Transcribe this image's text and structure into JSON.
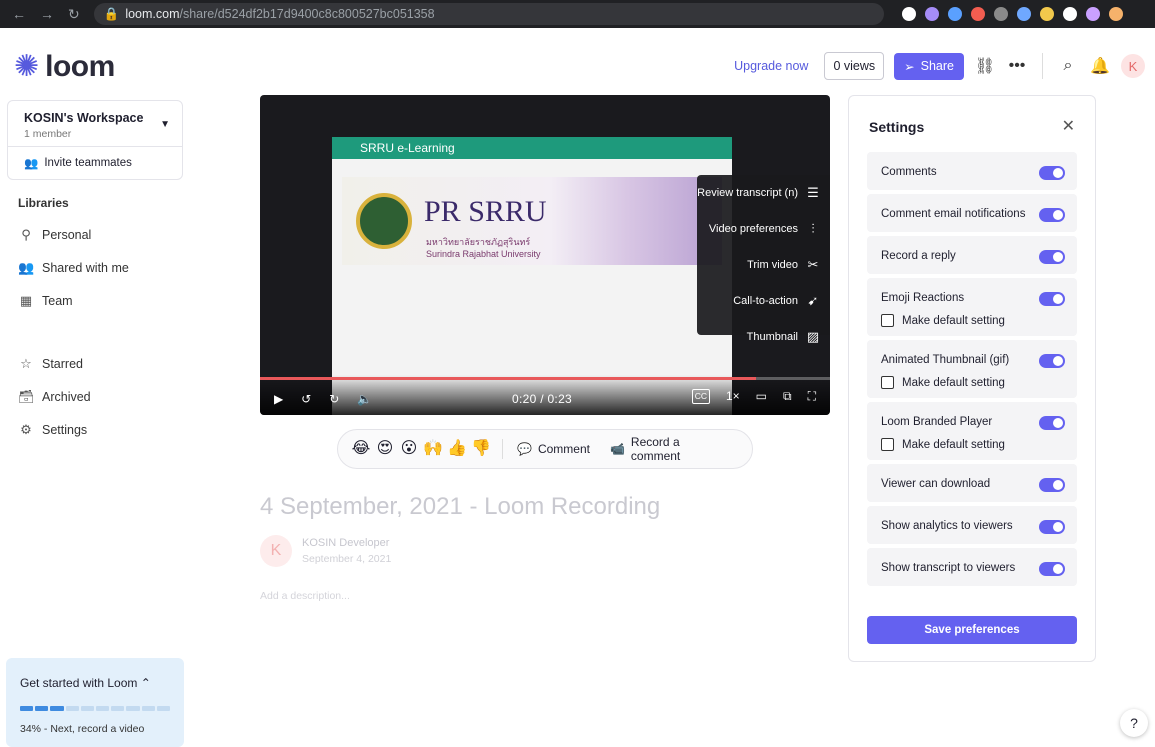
{
  "browser": {
    "url_host": "loom.com",
    "url_path": "/share/d524df2b17d9400c8c800527bc051358",
    "ext_colors": [
      "#ffffff",
      "#a58cf7",
      "#5aa0ff",
      "#f25d50",
      "#8a8a8a",
      "#6fa8ff",
      "#f2c94c",
      "#ffffff",
      "#c9a0ff",
      "#f6b26b"
    ]
  },
  "header": {
    "logo_text": "loom",
    "upgrade": "Upgrade now",
    "views": "0 views",
    "share": "Share",
    "avatar": "K"
  },
  "sidebar": {
    "workspace_name": "KOSIN's Workspace",
    "workspace_sub": "1 member",
    "invite": "Invite teammates",
    "libraries_heading": "Libraries",
    "nav_top": [
      {
        "label": "Personal",
        "icon": "person-icon"
      },
      {
        "label": "Shared with me",
        "icon": "people-icon"
      },
      {
        "label": "Team",
        "icon": "team-icon"
      }
    ],
    "nav_bottom": [
      {
        "label": "Starred",
        "icon": "star-icon"
      },
      {
        "label": "Archived",
        "icon": "archive-icon"
      },
      {
        "label": "Settings",
        "icon": "gear-icon"
      }
    ],
    "get_started": {
      "title": "Get started with Loom",
      "progress": 0.34,
      "note": "34% - Next, record a video"
    }
  },
  "video": {
    "screen_header": "SRRU e-Learning",
    "banner_title": "PR SRRU",
    "banner_sub_th": "มหาวิทยาลัยราชภัฏสุรินทร์",
    "banner_sub_en": "Surindra Rajabhat University",
    "menu": [
      {
        "label": "Review transcript (n)",
        "icon": "transcript-icon"
      },
      {
        "label": "Video preferences",
        "icon": "sliders-icon"
      },
      {
        "label": "Trim video",
        "icon": "scissors-icon"
      },
      {
        "label": "Call-to-action",
        "icon": "cursor-icon"
      },
      {
        "label": "Thumbnail",
        "icon": "image-icon"
      }
    ],
    "time": "0:20 / 0:23",
    "progress": 0.87,
    "speed": "1×",
    "cc": "CC"
  },
  "reactions": {
    "emojis": [
      "😂",
      "😍",
      "😮",
      "🙌",
      "👍",
      "👎"
    ],
    "comment": "Comment",
    "record": "Record a comment"
  },
  "recording": {
    "title": "4 September, 2021 - Loom Recording",
    "owner": "KOSIN Developer",
    "date": "September 4, 2021",
    "avatar": "K",
    "description_placeholder": "Add a description..."
  },
  "settings": {
    "heading": "Settings",
    "rows": [
      {
        "label": "Comments",
        "on": true
      },
      {
        "label": "Comment email notifications",
        "on": true
      },
      {
        "label": "Record a reply",
        "on": true
      },
      {
        "label": "Emoji Reactions",
        "on": true,
        "checkbox": "Make default setting"
      },
      {
        "label": "Animated Thumbnail (gif)",
        "on": true,
        "checkbox": "Make default setting"
      },
      {
        "label": "Loom Branded Player",
        "on": true,
        "checkbox": "Make default setting"
      },
      {
        "label": "Viewer can download",
        "on": true
      },
      {
        "label": "Show analytics to viewers",
        "on": true
      },
      {
        "label": "Show transcript to viewers",
        "on": true
      }
    ],
    "save": "Save preferences"
  },
  "help": "?"
}
